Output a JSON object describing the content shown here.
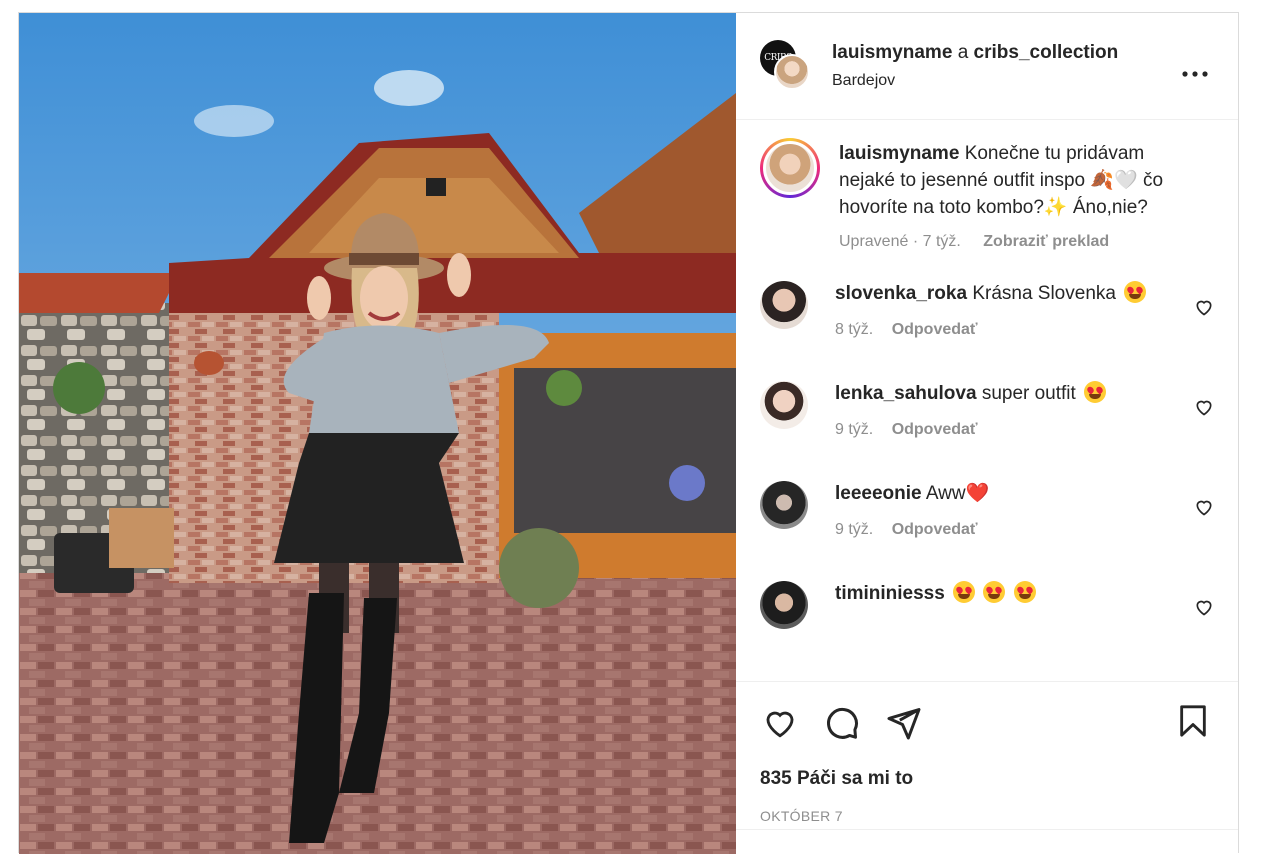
{
  "header": {
    "owner1": "lauismyname",
    "separator": "a",
    "owner2": "cribs_collection",
    "location": "Bardejov",
    "avatar_text": "CRIBS"
  },
  "caption": {
    "username": "lauismyname",
    "text": "Konečne tu pridávam nejaké to jesenné outfit inspo 🍂🤍 čo hovoríte na toto kombo?✨ Áno,nie?",
    "edited": "Upravené · 7 týž.",
    "translate": "Zobraziť preklad"
  },
  "comments": [
    {
      "username": "slovenka_roka",
      "text": "Krásna Slovenka",
      "emojis": 1,
      "time": "8 týž.",
      "reply": "Odpovedať",
      "avatar_color": "#d7c2b6"
    },
    {
      "username": "lenka_sahulova",
      "text": "super outfit",
      "emojis": 1,
      "time": "9 týž.",
      "reply": "Odpovedať",
      "avatar_color": "#efe4dd"
    },
    {
      "username": "leeeeonie",
      "text": "Aww❤️",
      "emojis": 0,
      "time": "9 týž.",
      "reply": "Odpovedať",
      "avatar_color": "#6b6b6b"
    },
    {
      "username": "timininiesss",
      "text": "",
      "emojis": 3,
      "time": "",
      "reply": "",
      "avatar_color": "#2f2f2f"
    }
  ],
  "actions": {
    "likes": "835 Páči sa mi to",
    "date": "OKTÓBER 7"
  },
  "colors": {
    "text": "#262626",
    "muted": "#8e8e8e",
    "border": "#dbdbdb"
  }
}
